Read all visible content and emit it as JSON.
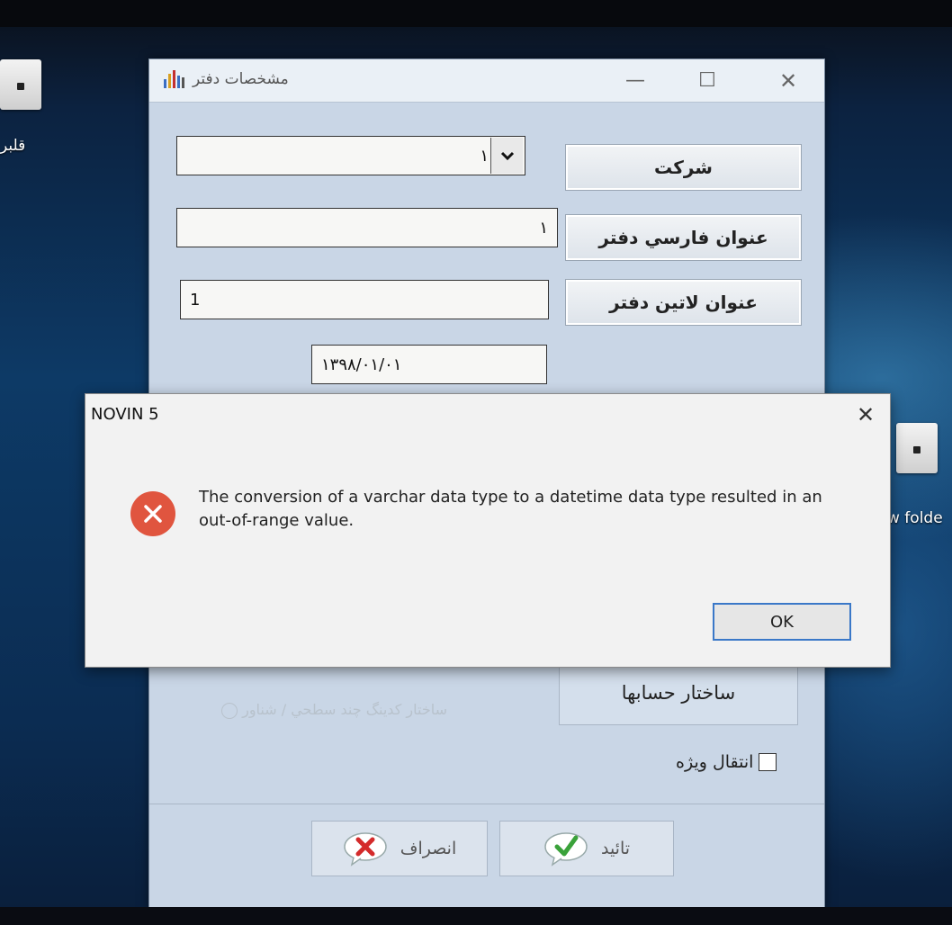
{
  "desktop": {
    "icon_left_label": "قلبر",
    "icon_right_label": "w folde"
  },
  "main_window": {
    "title": "مشخصات دفتر",
    "minimize": "—",
    "maximize": "☐",
    "close": "✕",
    "company_label": "شركت",
    "company_value": "١",
    "persian_title_label": "عنوان فارسي دفتر",
    "persian_title_value": "١",
    "latin_title_label": "عنوان لاتين دفتر",
    "latin_title_value": "1",
    "date_value": "١٣٩٨/٠١/٠١",
    "radio_option_1": "ساختار كدينگ چند سطحي / شناور",
    "structure_button": "ساختار حسابها",
    "special_transfer_label": "انتقال ويژه",
    "cancel_button": "انصراف",
    "confirm_button": "تائيد"
  },
  "error_dialog": {
    "title": "NOVIN 5",
    "close": "✕",
    "message": "The conversion of a varchar data type to a datetime data type resulted in an out-of-range value.",
    "ok_button": "OK"
  },
  "colors": {
    "error_red": "#e0553f",
    "ok_border": "#3a78c8",
    "confirm_check": "#3aa23a",
    "cancel_x": "#d42b2b"
  }
}
